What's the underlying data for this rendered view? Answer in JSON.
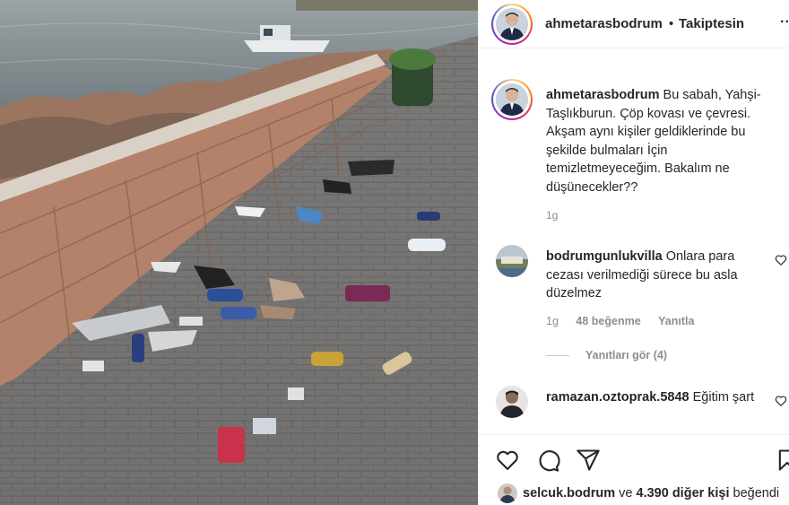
{
  "post": {
    "username": "ahmetarasbodrum",
    "separator": "•",
    "follow_status": "Takiptesin",
    "more": "...",
    "caption_user": "ahmetarasbodrum",
    "caption_text": " Bu sabah, Yahşi-Taşlıkburun. Çöp kovası ve çevresi. Akşam aynı kişiler geldiklerinde bu şekilde bulmaları İçin temizletmeyeceğim. Bakalım ne düşünecekler??",
    "caption_time": "1g"
  },
  "comments": [
    {
      "user": "bodrumgunlukvilla",
      "text": " Onlara para cezası verilmediği sürece bu asla düzelmez",
      "time": "1g",
      "likes": "48 beğenme",
      "reply": "Yanıtla",
      "see_replies": "Yanıtları gör (4)"
    },
    {
      "user": "ramazan.oztoprak.5848",
      "text": " Eğitim şart"
    }
  ],
  "likes": {
    "user": "selcuk.bodrum",
    "connector": " ve ",
    "others": "4.390 diğer kişi",
    "suffix": " beğendi"
  },
  "icons": {
    "like": "heart-icon",
    "comment": "comment-icon",
    "share": "send-icon",
    "save": "bookmark-icon"
  }
}
